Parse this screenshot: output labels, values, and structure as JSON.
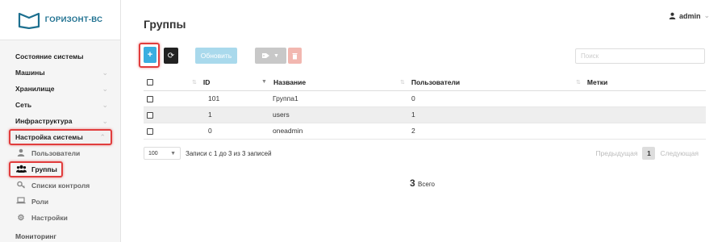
{
  "brand": {
    "name": "ГОРИЗОНТ-ВС",
    "color": "#1c6f8f"
  },
  "user": {
    "name": "admin",
    "icon": "user-icon"
  },
  "sidebar": {
    "items": [
      {
        "label": "Состояние системы",
        "has_chevron": false
      },
      {
        "label": "Машины",
        "has_chevron": true
      },
      {
        "label": "Хранилище",
        "has_chevron": true
      },
      {
        "label": "Сеть",
        "has_chevron": true
      },
      {
        "label": "Инфраструктура",
        "has_chevron": true
      },
      {
        "label": "Настройка системы",
        "has_chevron": true
      }
    ],
    "subitems": [
      {
        "label": "Пользователи",
        "icon": "user-icon"
      },
      {
        "label": "Группы",
        "icon": "users-icon"
      },
      {
        "label": "Списки контроля",
        "icon": "key-icon"
      },
      {
        "label": "Роли",
        "icon": "laptop-icon"
      },
      {
        "label": "Настройки",
        "icon": "gear-icon"
      }
    ],
    "bottom": "Мониторинг"
  },
  "page": {
    "title": "Группы"
  },
  "toolbar": {
    "add": "+",
    "refresh": "⟳",
    "update": "Обновить",
    "search_placeholder": "Поиск"
  },
  "table": {
    "columns": [
      "ID",
      "Название",
      "Пользователи",
      "Метки"
    ],
    "rows": [
      {
        "id": "101",
        "name": "Группа1",
        "users": "0",
        "labels": ""
      },
      {
        "id": "1",
        "name": "users",
        "users": "1",
        "labels": ""
      },
      {
        "id": "0",
        "name": "oneadmin",
        "users": "2",
        "labels": ""
      }
    ]
  },
  "footer": {
    "page_size": "100",
    "records_info": "Записи с 1 до 3 из 3 записей",
    "prev": "Предыдущая",
    "current_page": "1",
    "next": "Следующая"
  },
  "summary": {
    "count": "3",
    "label": "Всего"
  },
  "colors": {
    "accent": "#3aaee0",
    "highlight": "#e13d3d",
    "delete": "#f2b7b0",
    "update": "#a9d9ec"
  }
}
